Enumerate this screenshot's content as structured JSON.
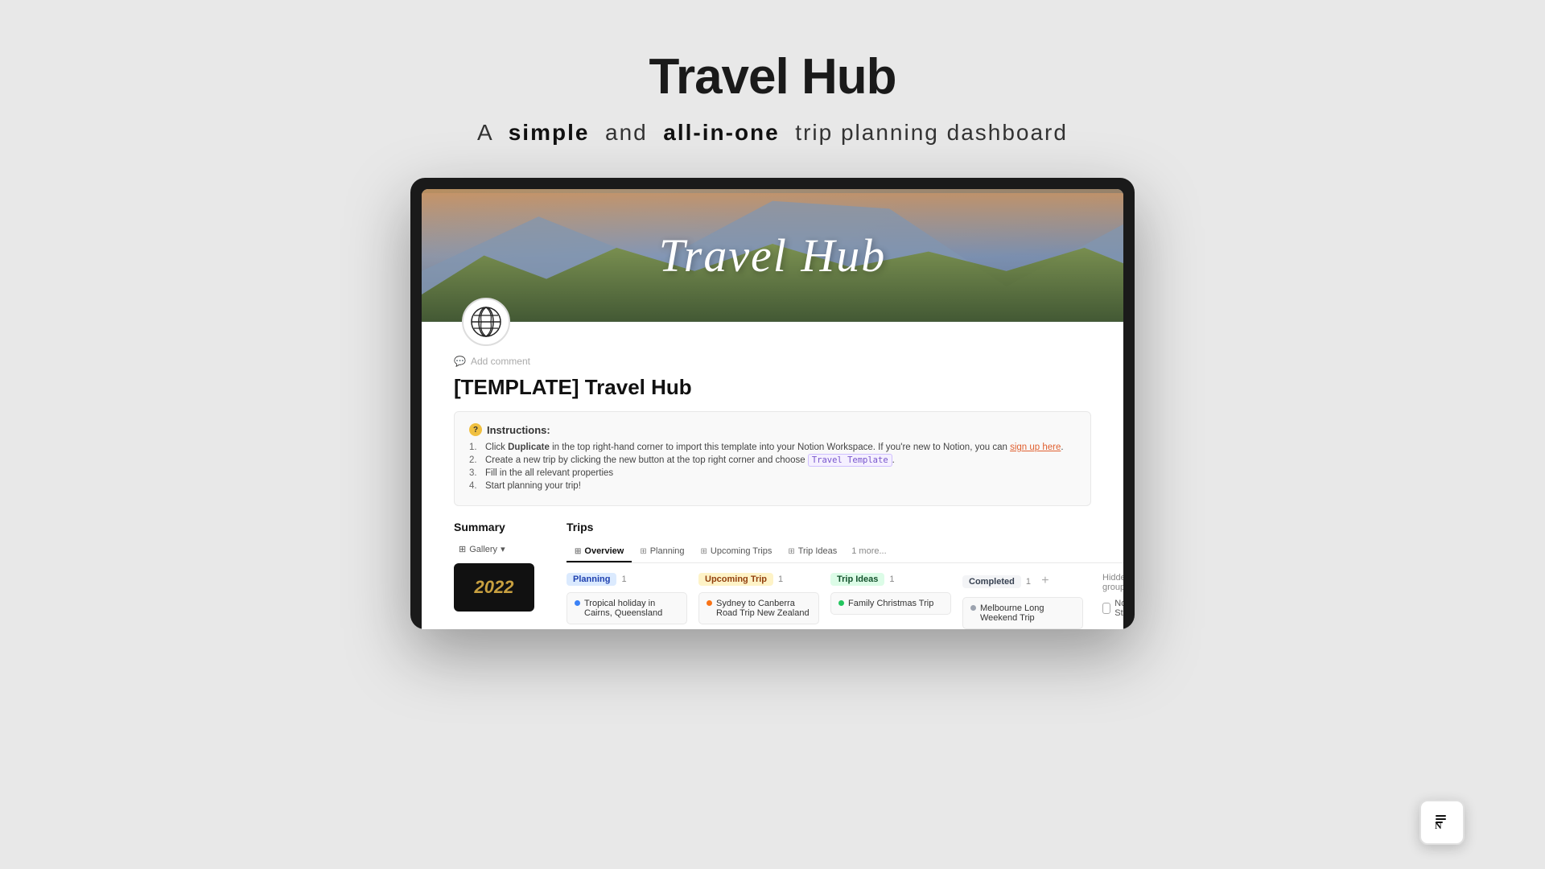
{
  "page": {
    "title": "Travel Hub",
    "subtitle_pre": "A",
    "subtitle_bold1": "simple",
    "subtitle_mid": "and",
    "subtitle_bold2": "all-in-one",
    "subtitle_post": "trip planning dashboard"
  },
  "hero": {
    "title": "Travel Hub"
  },
  "doc": {
    "add_comment": "Add comment",
    "title": "[TEMPLATE] Travel Hub"
  },
  "instructions": {
    "label": "Instructions:",
    "steps": [
      {
        "num": "1.",
        "text_pre": "Click ",
        "bold": "Duplicate",
        "text_mid": " in the top right-hand corner to import this template into your Notion Workspace. If you're new to Notion, you can ",
        "link": "sign up here",
        "text_post": "."
      },
      {
        "num": "2.",
        "text_pre": "Create a new trip by clicking the new button at the top right corner and choose ",
        "code": "Travel Template",
        "text_post": "."
      },
      {
        "num": "3.",
        "text": "Fill in the all relevant properties"
      },
      {
        "num": "4.",
        "text": "Start planning your trip!"
      }
    ]
  },
  "summary": {
    "label": "Summary",
    "gallery_btn": "Gallery",
    "year": "2022"
  },
  "trips": {
    "label": "Trips",
    "tabs": [
      {
        "id": "overview",
        "label": "Overview",
        "icon": "⊞",
        "active": true
      },
      {
        "id": "planning",
        "label": "Planning",
        "icon": "⊞"
      },
      {
        "id": "upcoming",
        "label": "Upcoming Trips",
        "icon": "⊞"
      },
      {
        "id": "ideas",
        "label": "Trip Ideas",
        "icon": "⊞"
      },
      {
        "id": "more",
        "label": "1 more..."
      }
    ],
    "columns": [
      {
        "id": "planning",
        "badge": "Planning",
        "badge_class": "badge-planning",
        "count": "1",
        "card_text": "Tropical holiday in Cairns, Queensland",
        "dot_class": "dot-blue"
      },
      {
        "id": "upcoming",
        "badge": "Upcoming Trip",
        "badge_class": "badge-upcoming",
        "count": "1",
        "card_text": "Sydney to Canberra Road Trip",
        "dot_class": "dot-orange"
      },
      {
        "id": "ideas",
        "badge": "Trip Ideas",
        "badge_class": "badge-ideas",
        "count": "1",
        "card_text": "Family Christmas Trip",
        "dot_class": "dot-green"
      },
      {
        "id": "completed",
        "badge": "Completed",
        "badge_class": "badge-completed",
        "count": "1",
        "card_text": "Melbourne Long Weekend Trip",
        "dot_class": "dot-gray"
      }
    ],
    "hidden_group_label": "Hidden group",
    "no_status_label": "No Statu"
  }
}
